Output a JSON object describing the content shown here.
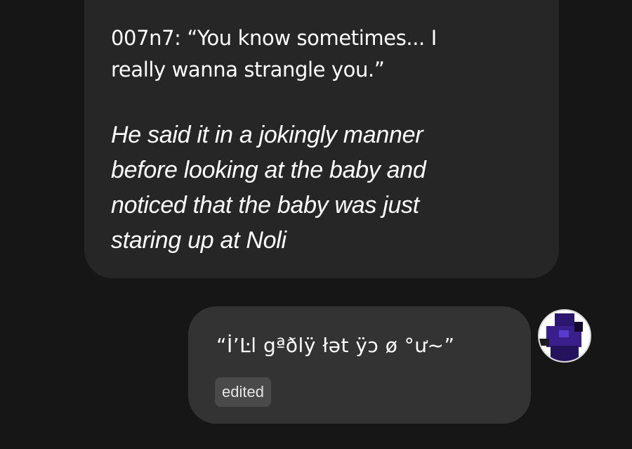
{
  "messages": [
    {
      "role": "character",
      "speech": "007n7: “You know sometimes... I\nreally wanna strangle you.”",
      "action": "He said it in a jokingly manner\nbefore looking at the baby and\nnoticed that the baby was just\nstaring up at Noli"
    },
    {
      "role": "user",
      "text": "“İ’Ŀl gªðlÿ łət ÿɔ ø °ư~”",
      "badge": "edited",
      "avatar_icon": "user-avatar-purple-figure"
    }
  ],
  "colors": {
    "background": "#161616",
    "incoming_bubble": "#262626",
    "outgoing_bubble": "#333333",
    "badge": "#4a4a4a",
    "avatar_purple": "#3a1f8a"
  }
}
